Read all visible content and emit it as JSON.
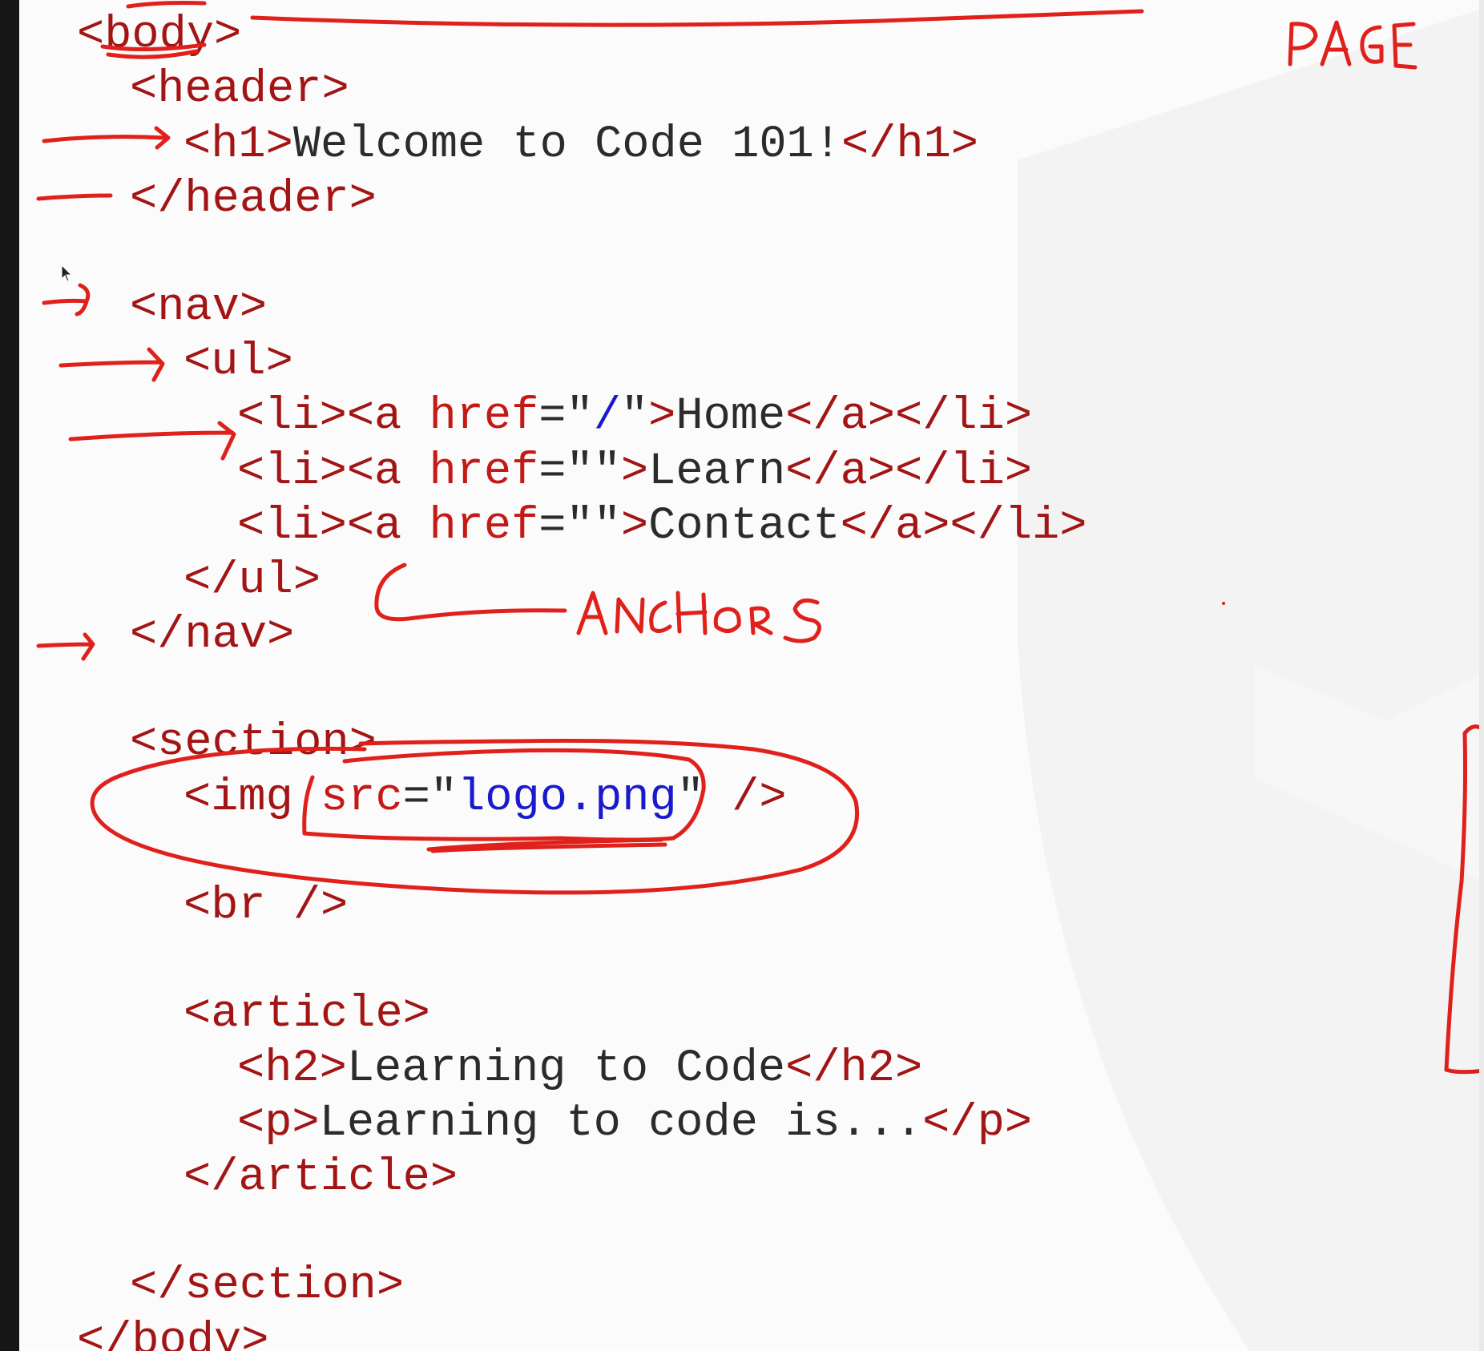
{
  "code_lines": [
    {
      "id": "body-open",
      "parts": [
        [
          "tag",
          "<body>"
        ]
      ]
    },
    {
      "id": "header-open",
      "parts": [
        [
          "tag",
          "<header>"
        ]
      ]
    },
    {
      "id": "h1",
      "parts": [
        [
          "tag",
          "<h1>"
        ],
        [
          "txt",
          "Welcome to Code 101!"
        ],
        [
          "tag",
          "</h1>"
        ]
      ]
    },
    {
      "id": "header-close",
      "parts": [
        [
          "tag",
          "</header>"
        ]
      ]
    },
    {
      "id": "nav-open",
      "parts": [
        [
          "tag",
          "<nav>"
        ]
      ]
    },
    {
      "id": "ul-open",
      "parts": [
        [
          "tag",
          "<ul>"
        ]
      ]
    },
    {
      "id": "li-home",
      "parts": [
        [
          "tag",
          "<li><a "
        ],
        [
          "attr",
          "href"
        ],
        [
          "pun",
          "=\""
        ],
        [
          "str",
          "/"
        ],
        [
          "pun",
          "\""
        ],
        [
          "tag",
          ">"
        ],
        [
          "txt",
          "Home"
        ],
        [
          "tag",
          "</a></li>"
        ]
      ]
    },
    {
      "id": "li-learn",
      "parts": [
        [
          "tag",
          "<li><a "
        ],
        [
          "attr",
          "href"
        ],
        [
          "pun",
          "=\"\""
        ],
        [
          "tag",
          ">"
        ],
        [
          "txt",
          "Learn"
        ],
        [
          "tag",
          "</a></li>"
        ]
      ]
    },
    {
      "id": "li-contact",
      "parts": [
        [
          "tag",
          "<li><a "
        ],
        [
          "attr",
          "href"
        ],
        [
          "pun",
          "=\"\""
        ],
        [
          "tag",
          ">"
        ],
        [
          "txt",
          "Contact"
        ],
        [
          "tag",
          "</a></li>"
        ]
      ]
    },
    {
      "id": "ul-close",
      "parts": [
        [
          "tag",
          "</ul>"
        ]
      ]
    },
    {
      "id": "nav-close",
      "parts": [
        [
          "tag",
          "</nav>"
        ]
      ]
    },
    {
      "id": "section-open",
      "parts": [
        [
          "tag",
          "<section>"
        ]
      ]
    },
    {
      "id": "img",
      "parts": [
        [
          "tag",
          "<img "
        ],
        [
          "attr",
          "src"
        ],
        [
          "pun",
          "=\""
        ],
        [
          "str",
          "logo.png"
        ],
        [
          "pun",
          "\" "
        ],
        [
          "tag",
          "/>"
        ]
      ]
    },
    {
      "id": "br",
      "parts": [
        [
          "tag",
          "<br />"
        ]
      ]
    },
    {
      "id": "article-open",
      "parts": [
        [
          "tag",
          "<article>"
        ]
      ]
    },
    {
      "id": "h2",
      "parts": [
        [
          "tag",
          "<h2>"
        ],
        [
          "txt",
          "Learning to Code"
        ],
        [
          "tag",
          "</h2>"
        ]
      ]
    },
    {
      "id": "p",
      "parts": [
        [
          "tag",
          "<p>"
        ],
        [
          "txt",
          "Learning to code is..."
        ],
        [
          "tag",
          "</p>"
        ]
      ]
    },
    {
      "id": "article-close",
      "parts": [
        [
          "tag",
          "</article>"
        ]
      ]
    },
    {
      "id": "section-close",
      "parts": [
        [
          "tag",
          "</section>"
        ]
      ]
    },
    {
      "id": "body-close",
      "parts": [
        [
          "tag",
          "</body>"
        ]
      ]
    }
  ],
  "annotations": {
    "page_note": "PAGE",
    "anchors_note": "ANCHORS"
  },
  "colors": {
    "ink": "#e0201b",
    "tag": "#a31515",
    "string": "#1a1acc",
    "text": "#2b2b2b"
  }
}
